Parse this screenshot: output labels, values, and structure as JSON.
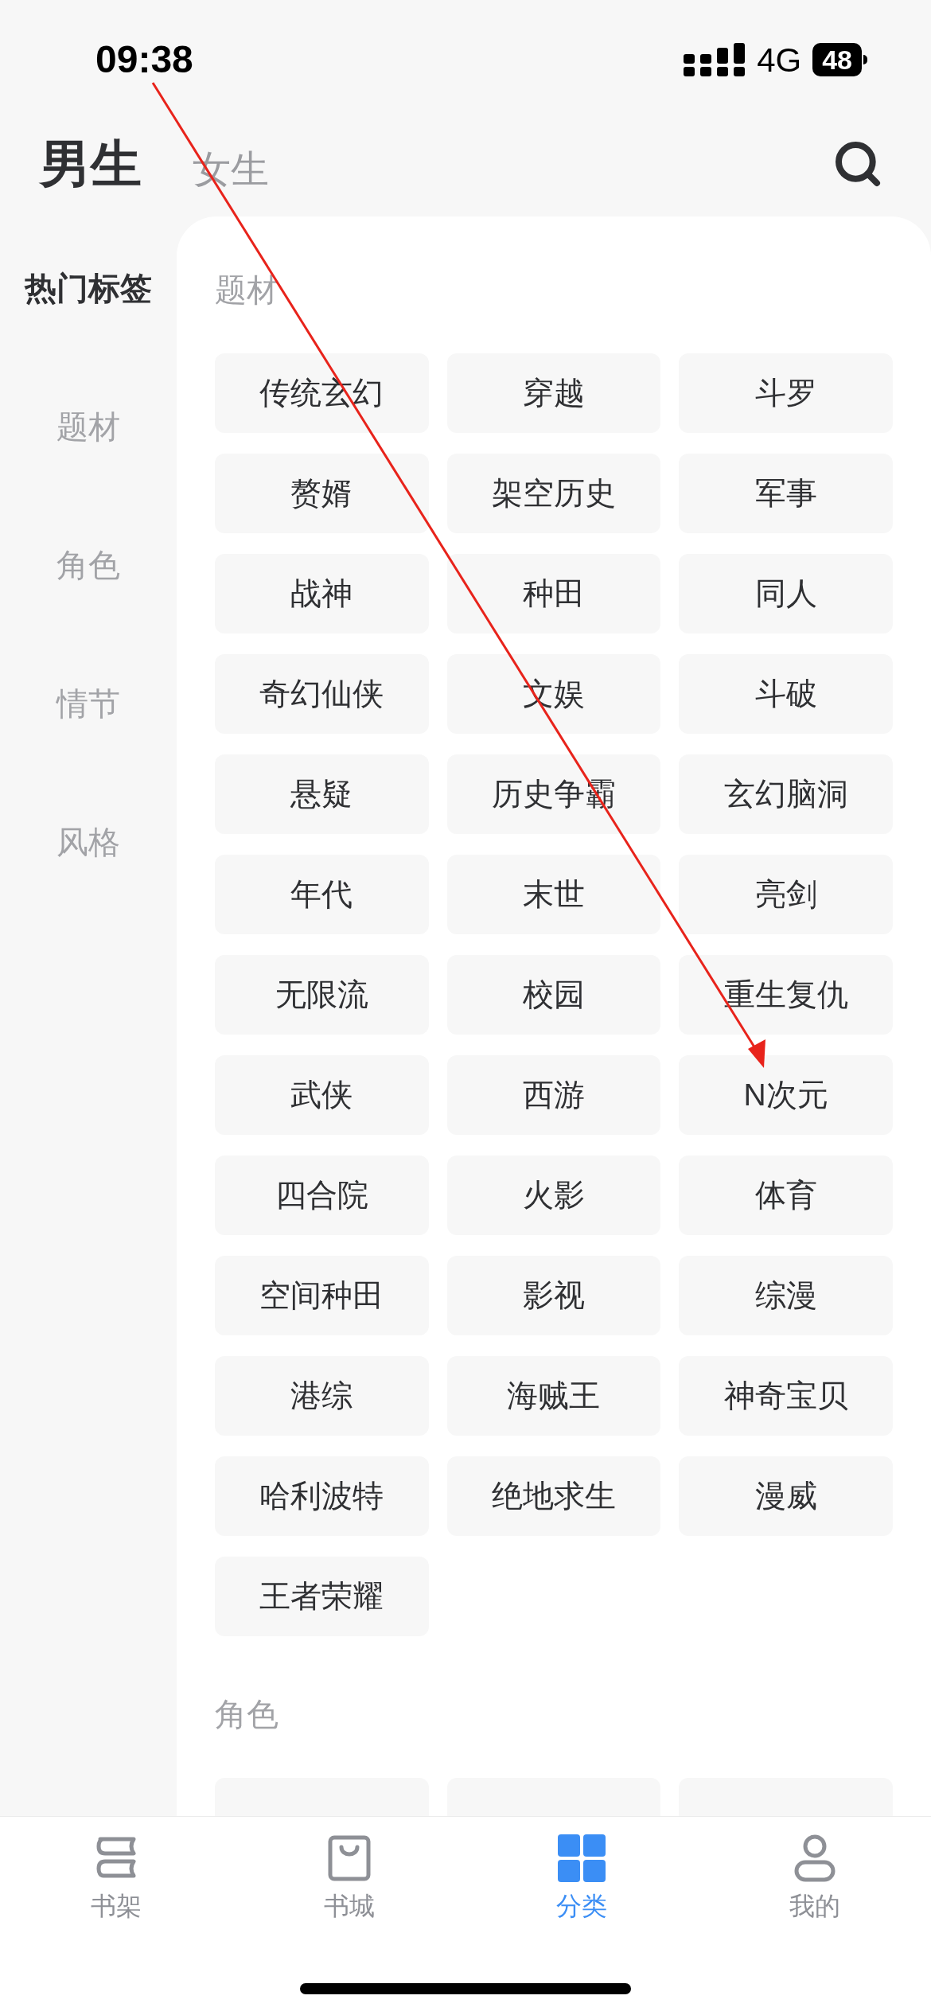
{
  "status_bar": {
    "time": "09:38",
    "network": "4G",
    "battery": "48"
  },
  "gender_tabs": [
    {
      "label": "男生",
      "selected": true
    },
    {
      "label": "女生",
      "selected": false
    }
  ],
  "sidebar": {
    "items": [
      {
        "label": "热门标签",
        "selected": true
      },
      {
        "label": "题材",
        "selected": false
      },
      {
        "label": "角色",
        "selected": false
      },
      {
        "label": "情节",
        "selected": false
      },
      {
        "label": "风格",
        "selected": false
      }
    ]
  },
  "sections": [
    {
      "title": "题材",
      "tags": [
        "传统玄幻",
        "穿越",
        "斗罗",
        "赘婿",
        "架空历史",
        "军事",
        "战神",
        "种田",
        "同人",
        "奇幻仙侠",
        "文娱",
        "斗破",
        "悬疑",
        "历史争霸",
        "玄幻脑洞",
        "年代",
        "末世",
        "亮剑",
        "无限流",
        "校园",
        "重生复仇",
        "武侠",
        "西游",
        "N次元",
        "四合院",
        "火影",
        "体育",
        "空间种田",
        "影视",
        "综漫",
        "港综",
        "海贼王",
        "神奇宝贝",
        "哈利波特",
        "绝地求生",
        "漫威",
        "王者荣耀"
      ]
    },
    {
      "title": "角色",
      "row_cut_off": true
    }
  ],
  "tab_bar": [
    {
      "label": "书架",
      "kind": "shelf",
      "selected": false
    },
    {
      "label": "书城",
      "kind": "store",
      "selected": false
    },
    {
      "label": "分类",
      "kind": "category",
      "selected": true
    },
    {
      "label": "我的",
      "kind": "profile",
      "selected": false
    }
  ]
}
